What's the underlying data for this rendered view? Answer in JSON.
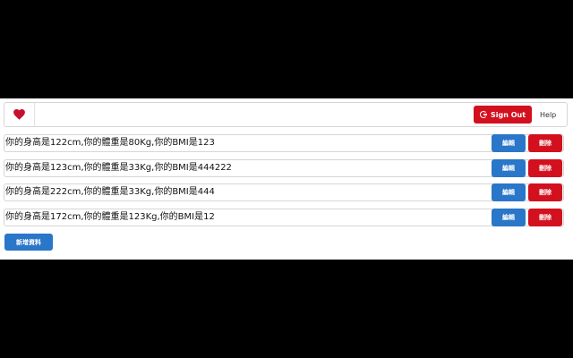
{
  "header": {
    "logo_icon": "heart-icon",
    "signout_icon": "google-icon",
    "signout_label": "Sign Out",
    "help_label": "Help",
    "brand_red": "#d3101e"
  },
  "records": [
    {
      "text": "你的身高是122cm,你的體重是80Kg,你的BMI是123",
      "edit_label": "編輯",
      "delete_label": "刪除"
    },
    {
      "text": "你的身高是123cm,你的體重是33Kg,你的BMI是444222",
      "edit_label": "編輯",
      "delete_label": "刪除"
    },
    {
      "text": "你的身高是222cm,你的體重是33Kg,你的BMI是444",
      "edit_label": "編輯",
      "delete_label": "刪除"
    },
    {
      "text": "你的身高是172cm,你的體重是123Kg,你的BMI是12",
      "edit_label": "編輯",
      "delete_label": "刪除"
    }
  ],
  "footer": {
    "add_label": "新增資料"
  },
  "colors": {
    "primary": "#2a76c8",
    "danger": "#d3101e"
  }
}
